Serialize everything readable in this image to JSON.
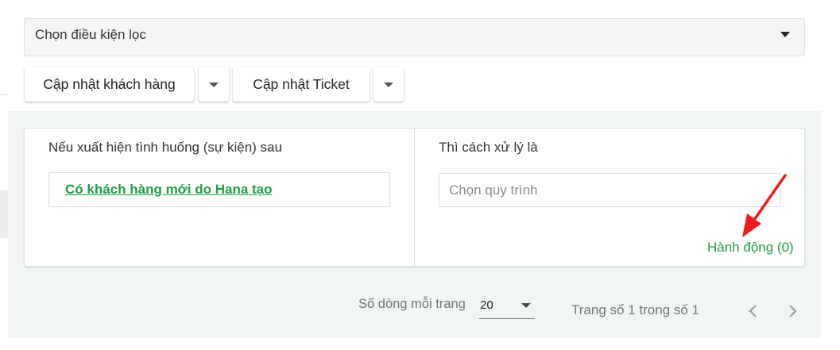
{
  "filter": {
    "label": "Chọn điều kiện lọc"
  },
  "actions": {
    "update_customer": "Cập nhật khách hàng",
    "update_ticket": "Cập nhật Ticket"
  },
  "rule": {
    "event_header": "Nếu xuất hiện tình huống (sự kiện) sau",
    "event_value": "Có khách hàng mới do Hana tạo",
    "handler_header": "Thì cách xử lý là",
    "process_placeholder": "Chọn quy trình",
    "action_link": "Hành động (0)"
  },
  "pagination": {
    "rows_label": "Số dòng mỗi trang",
    "rows_value": "20",
    "page_info": "Trang số 1 trong số 1"
  },
  "colors": {
    "accent": "#1e9e43",
    "arrow": "#ee1c1c",
    "panel_bg": "#f1f5f5"
  },
  "icons": [
    "caret-down-icon",
    "chevron-left-icon",
    "chevron-right-icon",
    "red-arrow-annotation"
  ]
}
